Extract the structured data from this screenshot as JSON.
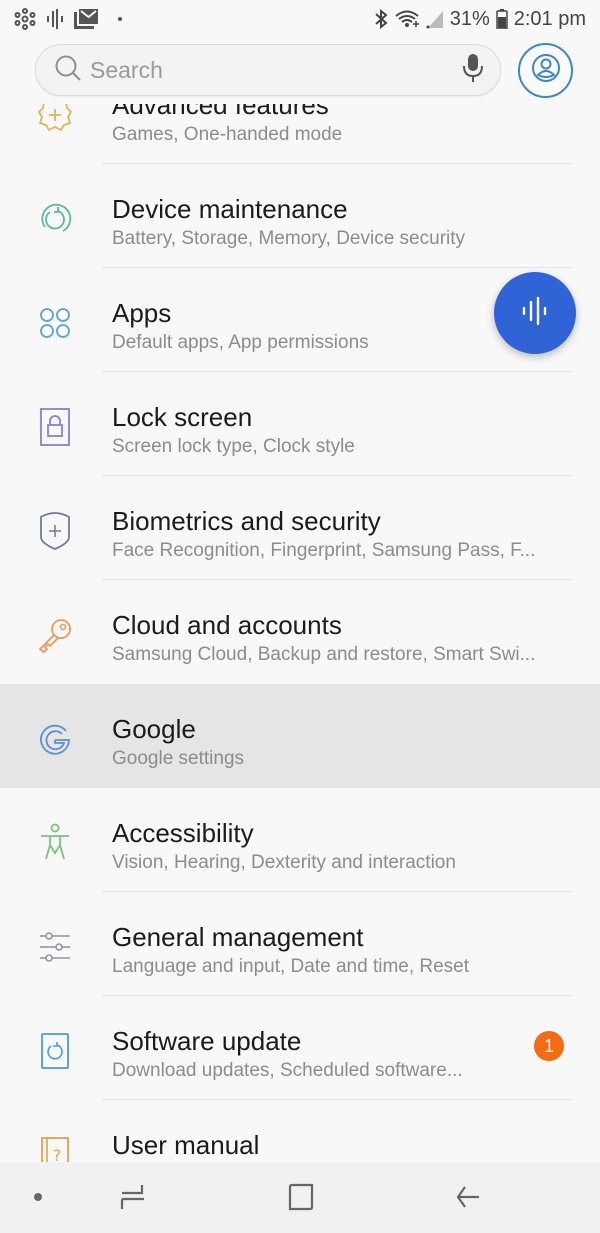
{
  "status_bar": {
    "left_icons": [
      "hub-icon",
      "voice-wave-icon",
      "gmail-icon",
      "dot-icon"
    ],
    "right_icons": [
      "bluetooth-icon",
      "wifi-icon",
      "signal-icon"
    ],
    "battery": "31%",
    "time": "2:01 pm"
  },
  "header": {
    "search_placeholder": "Search",
    "search_value": "",
    "mic_icon": "mic-icon",
    "profile_icon": "profile-icon"
  },
  "settings": {
    "items": [
      {
        "title": "Advanced features",
        "subtitle": "Games, One-handed mode",
        "icon": "gear-plus-icon",
        "color": "#e0b456"
      },
      {
        "title": "Device maintenance",
        "subtitle": "Battery, Storage, Memory, Device security",
        "icon": "refresh-circle-icon",
        "color": "#5bb9a0"
      },
      {
        "title": "Apps",
        "subtitle": "Default apps, App permissions",
        "icon": "apps-grid-icon",
        "color": "#5aa2cf"
      },
      {
        "title": "Lock screen",
        "subtitle": "Screen lock type, Clock style",
        "icon": "lock-icon",
        "color": "#8a7fcf"
      },
      {
        "title": "Biometrics and security",
        "subtitle": "Face Recognition, Fingerprint, Samsung Pass, F...",
        "icon": "shield-icon",
        "color": "#6f7c93"
      },
      {
        "title": "Cloud and accounts",
        "subtitle": "Samsung Cloud, Backup and restore, Smart Swi...",
        "icon": "key-icon",
        "color": "#e99a5d"
      },
      {
        "title": "Google",
        "subtitle": "Google settings",
        "icon": "google-icon",
        "color": "#5b8fd9",
        "highlighted": true
      },
      {
        "title": "Accessibility",
        "subtitle": "Vision, Hearing, Dexterity and interaction",
        "icon": "accessibility-icon",
        "color": "#7dc27c"
      },
      {
        "title": "General management",
        "subtitle": "Language and input, Date and time, Reset",
        "icon": "sliders-icon",
        "color": "#8f96a0"
      },
      {
        "title": "Software update",
        "subtitle": "Download updates, Scheduled software...",
        "icon": "update-icon",
        "color": "#4a9ad9",
        "badge": "1"
      },
      {
        "title": "User manual",
        "subtitle": "",
        "icon": "manual-icon",
        "color": "#e3a24a"
      }
    ]
  },
  "fab": {
    "icon": "voice-assistant-icon",
    "color": "#2f63d6"
  },
  "badge_color": "#f36b12",
  "nav_bar": {
    "buttons": [
      "dot-indicator",
      "recents",
      "home",
      "back"
    ]
  }
}
